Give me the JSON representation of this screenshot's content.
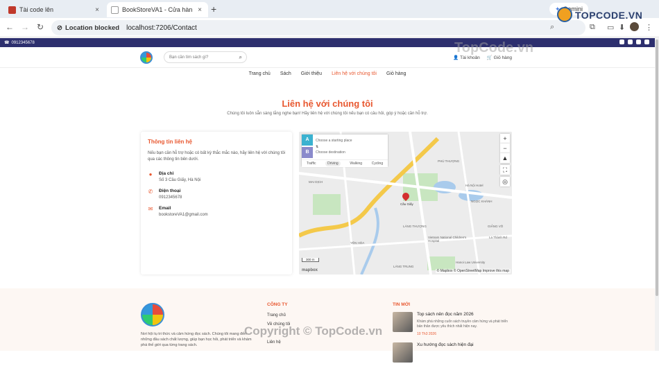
{
  "browser": {
    "tabs": [
      {
        "title": "Tài code lên",
        "close": "×"
      },
      {
        "title": "BookStoreVA1 - Cửa hàng sách",
        "close": "×"
      }
    ],
    "new_tab": "+",
    "gemini_label": "Gemini",
    "location_blocked": "Location blocked",
    "url": "localhost:7206/Contact"
  },
  "site": {
    "phone_strip": "0912345678",
    "search_placeholder": "Bạn cần tìm sách gì?",
    "header_links": [
      "Tài khoản",
      "Giỏ hàng"
    ],
    "nav": [
      "Trang chủ",
      "Sách",
      "Giới thiệu",
      "Liên hệ với chúng tôi",
      "Giỏ hàng"
    ],
    "nav_active_index": 3,
    "page_title": "Liên hệ với chúng tôi",
    "page_subtitle": "Chúng tôi luôn sẵn sàng lắng nghe bạn! Hãy liên hệ với chúng tôi nếu bạn có câu hỏi, góp ý hoặc cần hỗ trợ.",
    "accent": "#e8572f"
  },
  "contact": {
    "heading": "Thông tin liên hệ",
    "description": "Nếu bạn cần hỗ trợ hoặc có bất kỳ thắc mắc nào, hãy liên hệ với chúng tôi qua các thông tin bên dưới.",
    "address_label": "Địa chỉ",
    "address": "Số 3 Cầu Giấy, Hà Nội",
    "phone_label": "Điện thoại",
    "phone": "0912345678",
    "email_label": "Email",
    "email": "bookstoreVA1@gmail.com"
  },
  "map": {
    "start_placeholder": "Choose a starting place",
    "dest_placeholder": "Choose destination",
    "modes": [
      "Traffic",
      "Driving",
      "Walking",
      "Cycling"
    ],
    "selected_mode": "Driving",
    "pin_label": "Cầu Giấy",
    "attribution": "© Mapbox © OpenStreetMap Improve this map",
    "scale": "300 m",
    "logo": "mapbox",
    "places": [
      "NGỌC KHÁNH",
      "LÁNG THƯỢNG",
      "LÁNG TRUNG",
      "Hà Nội Hotel",
      "Vietnam National Children's Hospital",
      "Hanoi Law University",
      "GIẢNG VÕ",
      "La Thành Rd",
      "MAI DỊCH",
      "YÊN HÒA",
      "PHÚ THƯỢNG"
    ]
  },
  "footer": {
    "description": "Nơi hội tụ tri thức và cảm hứng đọc sách. Chúng tôi mang đến những đầu sách chất lượng, giúp bạn học hỏi, phát triển và khám phá thế giới qua từng trang sách.",
    "company_heading": "CÔNG TY",
    "company_links": [
      "Trang chủ",
      "Về chúng tôi",
      "",
      "Liên hệ"
    ],
    "news_heading": "TIN MỚI",
    "news": [
      {
        "title": "Top sách nên đọc năm 2026",
        "desc": "Khám phá những cuốn sách truyền cảm hứng và phát triển bản thân được yêu thích nhất hiện nay.",
        "date": "10 Th3 2026"
      },
      {
        "title": "Xu hướng đọc sách hiện đại",
        "desc": "",
        "date": ""
      }
    ]
  },
  "watermarks": {
    "center": "TopCode.vn",
    "copyright": "Copyright © TopCode.vn",
    "badge": "TOPCODE.VN"
  }
}
